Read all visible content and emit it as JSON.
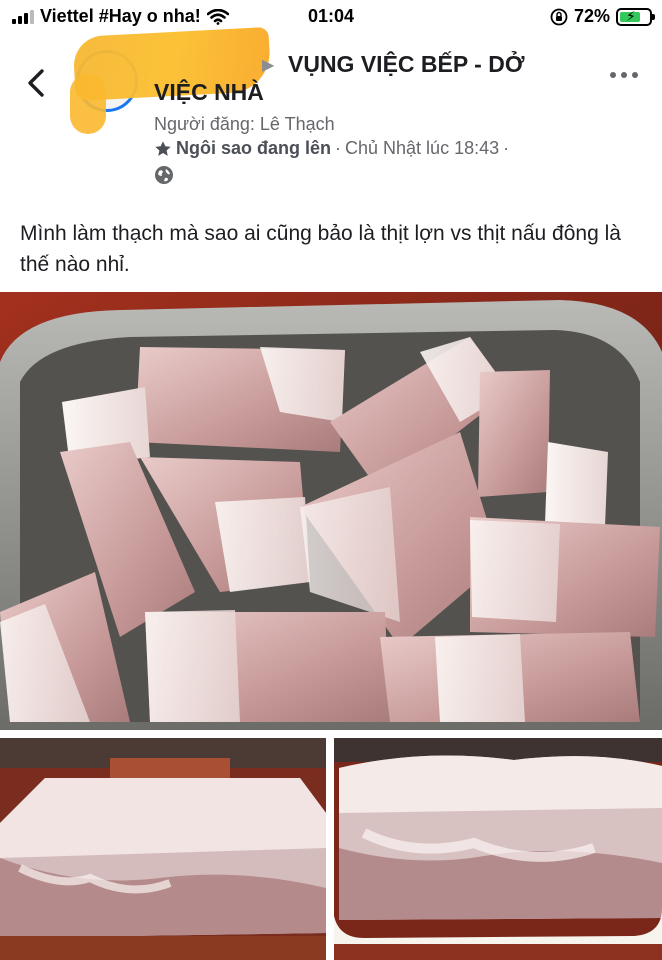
{
  "status_bar": {
    "carrier": "Viettel #Hay o nha!",
    "time": "01:04",
    "battery_percent": "72%",
    "battery_level": 0.72,
    "icons": [
      "signal-icon",
      "wifi-icon",
      "rotation-lock-icon",
      "battery-charging-icon"
    ]
  },
  "header": {
    "back_icon": "chevron-left-icon",
    "group_name": "VỤNG VIỆC BẾP - DỞ VIỆC NHÀ",
    "poster": "Người đăng: Lê Thạch",
    "badge": "Ngôi sao đang lên",
    "separator": "·",
    "timestamp": "Chủ Nhật lúc 18:43",
    "more_icon": "more-horizontal-icon",
    "privacy_icon": "globe-icon"
  },
  "post": {
    "text": "Mình làm thạch mà sao ai cũng bảo là thịt lợn vs thịt nấu đông là thế nào nhỉ."
  },
  "colors": {
    "accent": "#1877f2",
    "secondary_text": "#65676b",
    "primary_text": "#1c1e21",
    "battery_fill": "#34c759"
  }
}
